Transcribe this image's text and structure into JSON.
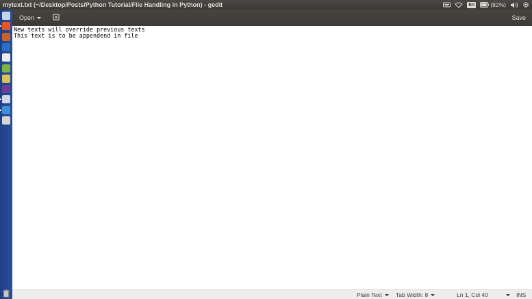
{
  "window": {
    "title": "mytext.txt (~/Desktop/Posts/Python Tutorial/File Handling in Python) - gedit"
  },
  "top_panel": {
    "indicators": [
      {
        "icon": "keyboard-icon"
      },
      {
        "icon": "wifi-icon"
      },
      {
        "icon": "language-icon",
        "label": "En"
      },
      {
        "icon": "battery-icon",
        "label": "(82%)",
        "level_percent": 82
      },
      {
        "icon": "volume-icon"
      },
      {
        "icon": "gear-icon"
      }
    ]
  },
  "toolbar": {
    "open_label": "Open",
    "new_tab_icon": "new-document-icon",
    "save_label": "Save"
  },
  "editor": {
    "lines": [
      "New texts will override previous texts",
      "This text is to be appendend in file"
    ]
  },
  "status_bar": {
    "syntax": "Plain Text",
    "tab_width": "Tab Width: 8",
    "cursor": "Ln 1, Col 40",
    "mode": "INS"
  },
  "launcher": {
    "colors": [
      "#c9d4ea",
      "#e95420",
      "#c7622c",
      "#2b6fc0",
      "#ebebeb",
      "#7cb342",
      "#d8c25a",
      "#6a3f96",
      "#cfd6e6",
      "#3d8fd6",
      "#d6d6d6"
    ],
    "trash_icon": "trash-icon"
  }
}
